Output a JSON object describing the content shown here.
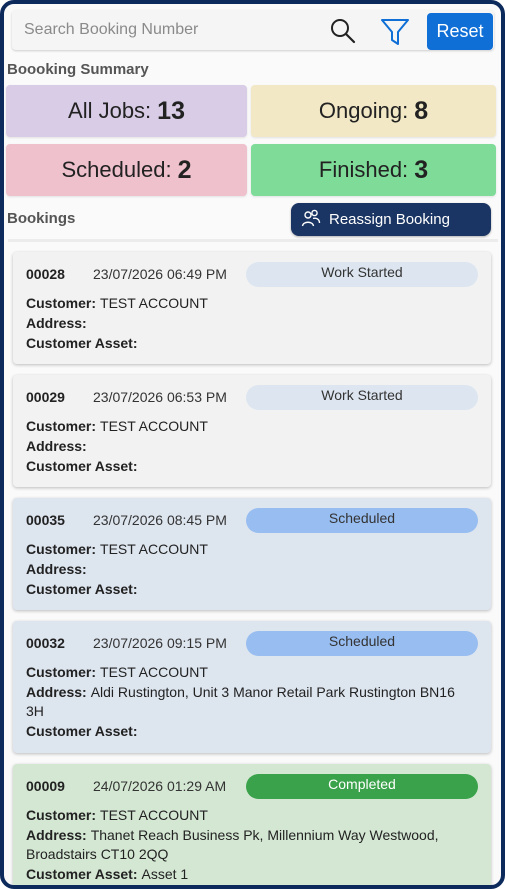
{
  "search": {
    "placeholder": "Search Booking Number"
  },
  "toolbar": {
    "reset_label": "Reset",
    "search_icon": "search-icon",
    "filter_icon": "filter-icon"
  },
  "summary": {
    "heading": "Boooking Summary",
    "cards": [
      {
        "label": "All Jobs:",
        "count": "13",
        "color": "#d8cce6"
      },
      {
        "label": "Ongoing:",
        "count": "8",
        "color": "#f2e8c6"
      },
      {
        "label": "Scheduled:",
        "count": "2",
        "color": "#efc1cd"
      },
      {
        "label": "Finished:",
        "count": "3",
        "color": "#7fdb98"
      }
    ]
  },
  "bookings": {
    "heading": "Bookings",
    "reassign_label": "Reassign Booking",
    "field_labels": {
      "customer": "Customer:",
      "address": "Address:",
      "asset": "Customer Asset:"
    },
    "items": [
      {
        "number": "00028",
        "datetime": "23/07/2026 06:49 PM",
        "status": "Work Started",
        "customer": "TEST ACCOUNT",
        "address": "",
        "asset": ""
      },
      {
        "number": "00029",
        "datetime": "23/07/2026 06:53 PM",
        "status": "Work Started",
        "customer": "TEST ACCOUNT",
        "address": "",
        "asset": ""
      },
      {
        "number": "00035",
        "datetime": "23/07/2026 08:45 PM",
        "status": "Scheduled",
        "customer": "TEST ACCOUNT",
        "address": "",
        "asset": ""
      },
      {
        "number": "00032",
        "datetime": "23/07/2026 09:15 PM",
        "status": "Scheduled",
        "customer": "TEST ACCOUNT",
        "address": "Aldi Rustington, Unit 3 Manor Retail Park Rustington BN16 3H",
        "asset": ""
      },
      {
        "number": "00009",
        "datetime": "24/07/2026 01:29 AM",
        "status": "Completed",
        "customer": "TEST ACCOUNT",
        "address": "Thanet Reach Business Pk, Millennium Way Westwood, Broadstairs CT10 2QQ",
        "asset": "Asset 1"
      }
    ]
  },
  "colors": {
    "work_started_bg": "#f2f2f2",
    "work_started_pill": "#dde6f0",
    "scheduled_bg": "#dde5ef",
    "scheduled_pill": "#98bdf0",
    "completed_bg": "#d4e7d3",
    "completed_pill": "#3aa24a",
    "accent": "#0f6fd6",
    "reassign": "#1a3563"
  }
}
